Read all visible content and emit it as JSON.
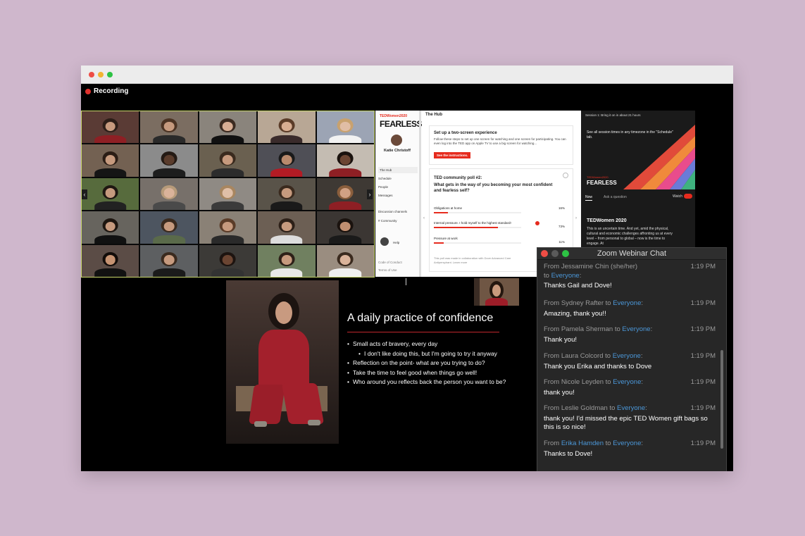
{
  "recording": {
    "label": "Recording"
  },
  "ted": {
    "brand": "TEDWomen2020",
    "event_name": "FEARLESS",
    "user_name": "Katie Christoff",
    "nav": [
      "The Hub",
      "Schedule",
      "People",
      "Messages",
      "Discussion channels",
      "# Community",
      "Help",
      "Code of Conduct",
      "Terms of Use"
    ],
    "hub_title": "The Hub",
    "setup_card": {
      "title": "Set up a two-screen experience",
      "body": "Follow these steps to set up one screen for watching and one screen for participating. You can even log into the TED app on Apple TV to use a big screen for watching...",
      "button": "See the instructions."
    },
    "poll": {
      "label": "TED community poll #2:",
      "question": "What gets in the way of you becoming your most confident and fearless self?",
      "options": [
        {
          "label": "Obligations at home",
          "pct_label": "16%",
          "pct": 16
        },
        {
          "label": "Internal pressure. I hold myself to the highest standard!",
          "pct_label": "73%",
          "pct": 73
        },
        {
          "label": "Pressure at work",
          "pct_label": "11%",
          "pct": 11
        }
      ],
      "footnote": "This poll was made in collaboration with Dove Advanced Care Antiperspirant. Learn more"
    },
    "session": {
      "header": "Session 1: Bring it on in about 21 hours",
      "note": "See all session times in any timezone in the \"Schedule\" tab.",
      "tabs": [
        "Now",
        "Ask a question"
      ],
      "watch_label": "Watch",
      "event_title": "TEDWomen 2020",
      "body": "This is an uncertain time. And yet, amid the physical, cultural and economic challenges affronting us at every level – from personal to global – now is the time to engage. At"
    }
  },
  "slide": {
    "title": "A daily practice of confidence",
    "bullets": [
      {
        "text": "Small acts of bravery, every day",
        "level": 1
      },
      {
        "text": "I don't like doing this, but I'm going to try it anyway",
        "level": 2
      },
      {
        "text": "Reflection on the point- what are you trying to do?",
        "level": 1
      },
      {
        "text": "Take the time to feel good when things go well!",
        "level": 1
      },
      {
        "text": "Who around you reflects back the person you want to be?",
        "level": 1
      }
    ]
  },
  "chat": {
    "title": "Zoom Webinar Chat",
    "messages": [
      {
        "from": "Jessamine Chin (she/her)",
        "to": "Everyone",
        "time": "1:19 PM",
        "text": "Thanks Gail and Dove!"
      },
      {
        "from": "Sydney Rafter",
        "to": "Everyone",
        "time": "1:19 PM",
        "text": "Amazing, thank you!!"
      },
      {
        "from": "Pamela Sherman",
        "to": "Everyone",
        "time": "1:19 PM",
        "text": "Thank you!"
      },
      {
        "from": "Laura Colcord",
        "to": "Everyone",
        "time": "1:19 PM",
        "text": "Thank you Erika and thanks to Dove"
      },
      {
        "from": "Nicole Leyden",
        "to": "Everyone",
        "time": "1:19 PM",
        "text": "thank you!"
      },
      {
        "from": "Leslie Goldman",
        "to": "Everyone",
        "time": "1:19 PM",
        "text": "thank you! I'd missed the epic TED Women gift bags so this is so nice!"
      },
      {
        "from": "Erika Hamden",
        "to": "Everyone",
        "time": "1:19 PM",
        "text": "Thanks to Dove!"
      }
    ]
  },
  "colors": {
    "accent_red": "#e62b1e",
    "chat_blue": "#4b97d8",
    "active_speaker": "#c9d86b",
    "background": "#cfb7cc"
  }
}
